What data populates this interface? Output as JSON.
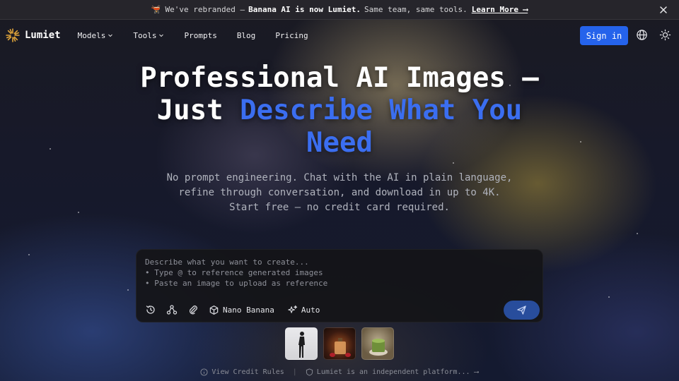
{
  "banner": {
    "lead_emoji": "🫕",
    "text_before": "We've rebranded —",
    "highlight": "Banana AI is now Lumiet.",
    "text_after": "Same team, same tools.",
    "link": "Learn More ⟶"
  },
  "nav": {
    "brand": "Lumiet",
    "items": [
      {
        "label": "Models",
        "dropdown": true
      },
      {
        "label": "Tools",
        "dropdown": true
      },
      {
        "label": "Prompts",
        "dropdown": false
      },
      {
        "label": "Blog",
        "dropdown": false
      },
      {
        "label": "Pricing",
        "dropdown": false
      }
    ],
    "signin": "Sign in"
  },
  "hero": {
    "title_line1": "Professional AI Images —",
    "title_line2_plain": "Just",
    "title_line2_blue": "Describe What You",
    "title_line3_blue": "Need",
    "subtitle": "No prompt engineering. Chat with the AI in plain language, refine through conversation, and download in up to 4K. Start free — no credit card required."
  },
  "composer": {
    "placeholder": "Describe what you want to create...\n• Type @ to reference generated images\n• Paste an image to upload as reference",
    "model_chip": "Nano Banana",
    "mode_chip": "Auto"
  },
  "footer": {
    "credit_link": "View Credit Rules",
    "separator": "|",
    "platform_link": "Lumiet is an independent platform... ⟶"
  },
  "colors": {
    "accent": "#2563eb",
    "title_blue": "#3b6ef0",
    "send_button": "#284d9c"
  }
}
